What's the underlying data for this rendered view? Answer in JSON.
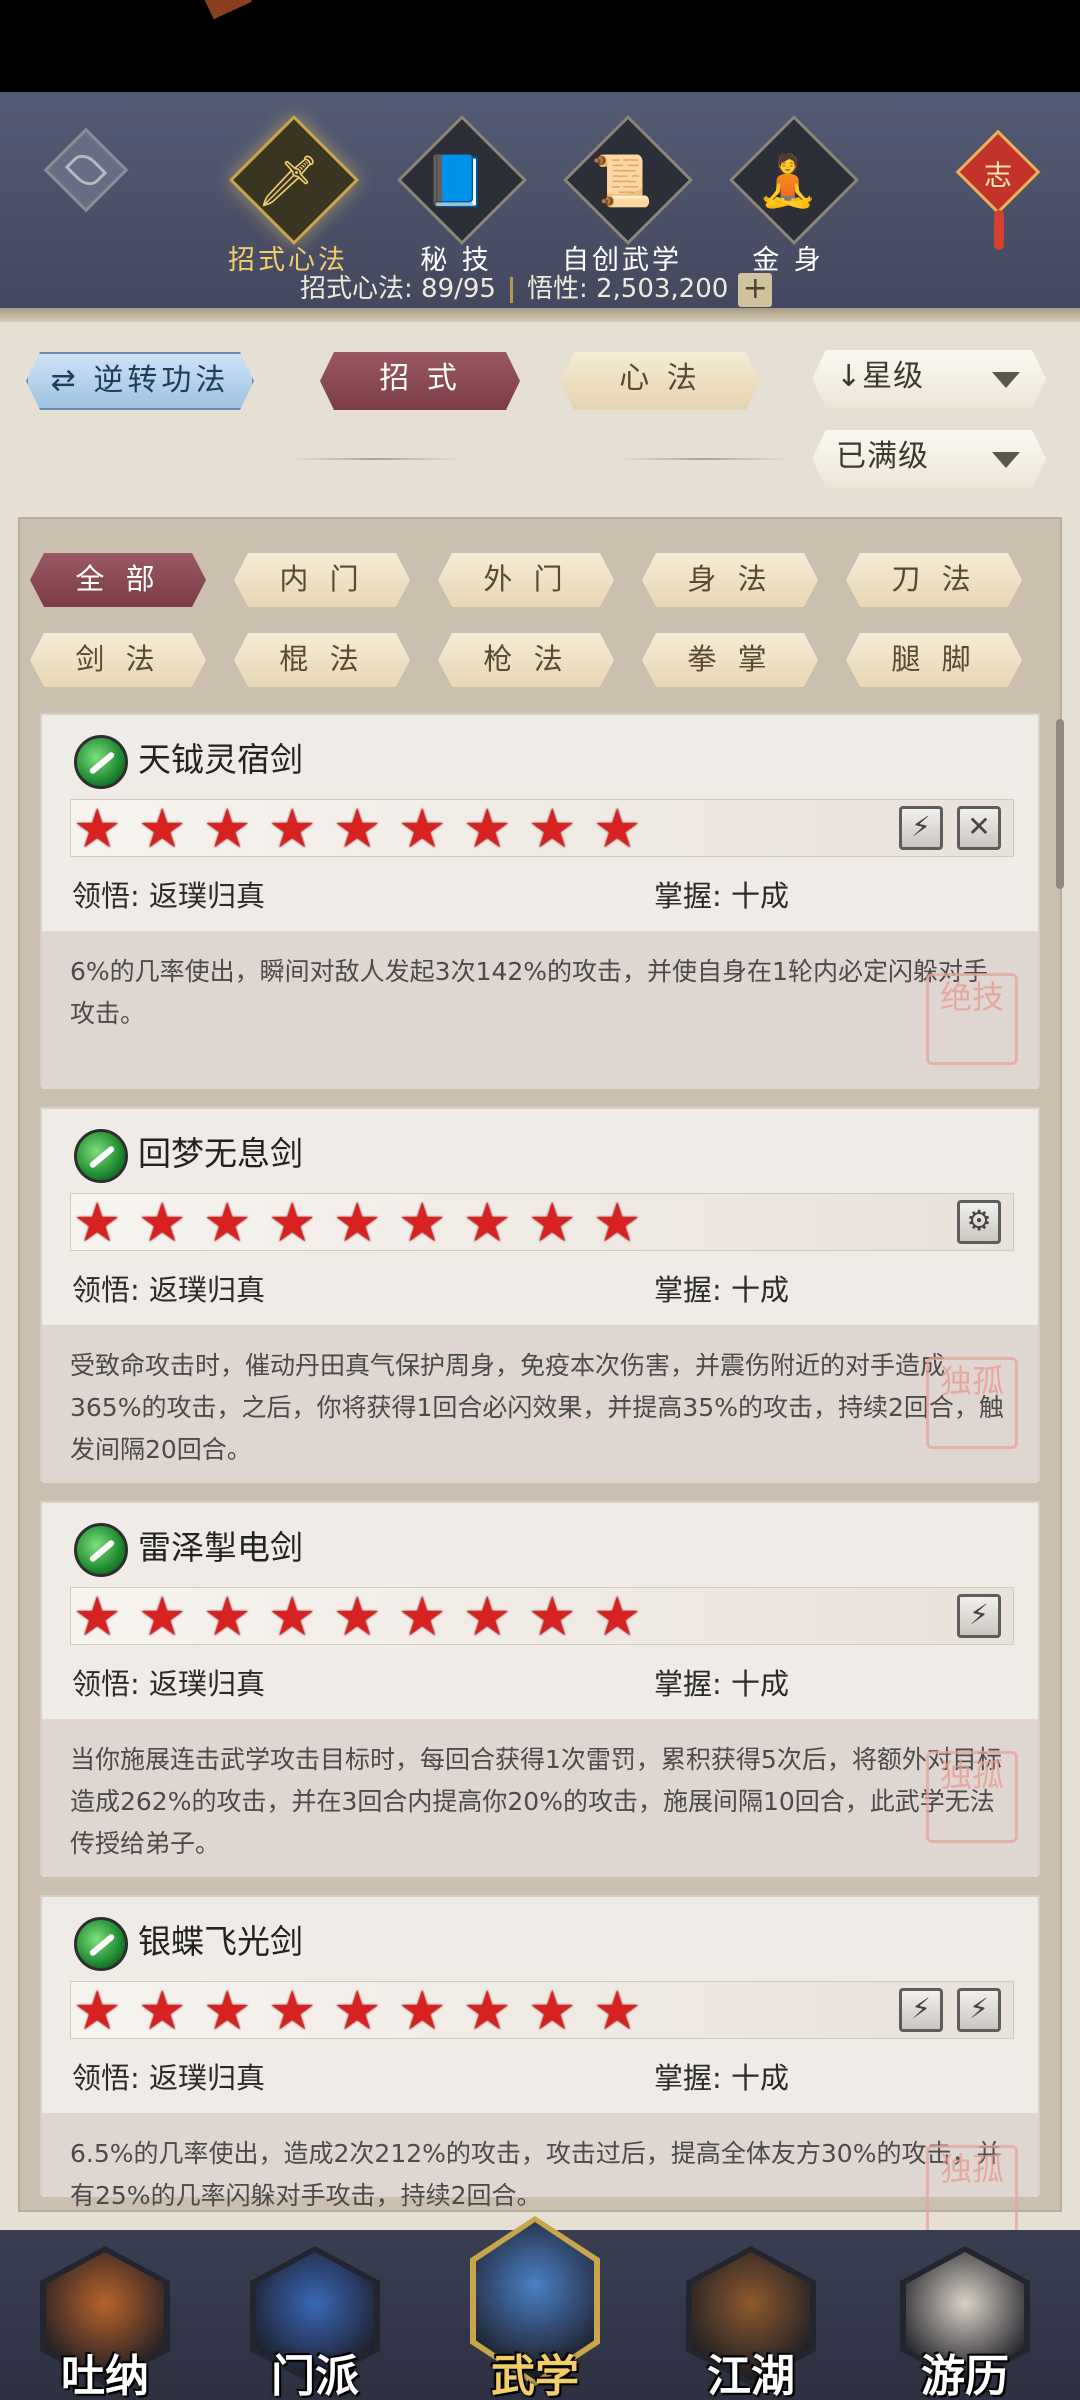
{
  "top_nav": {
    "tabs": [
      {
        "label": "招式心法",
        "icon": "sword-icon",
        "active": true
      },
      {
        "label": "秘 技",
        "icon": "book-icon",
        "active": false
      },
      {
        "label": "自创武学",
        "icon": "scroll-icon",
        "active": false
      },
      {
        "label": "金 身",
        "icon": "meditation-icon",
        "active": false
      }
    ],
    "knot_char": "志",
    "stats": {
      "moves_label": "招式心法: 89/95",
      "insight_label": "悟性: 2,503,200",
      "plus": "+"
    }
  },
  "toolbar": {
    "reverse_label": "逆转功法",
    "reverse_icon": "⇄",
    "move_tab": "招 式",
    "heart_tab": "心 法",
    "sort_label": "星级",
    "sort_arrow": "↓",
    "filter_label": "已满级"
  },
  "categories": [
    "全 部",
    "内 门",
    "外 门",
    "身 法",
    "刀 法",
    "剑 法",
    "棍 法",
    "枪 法",
    "拳 掌",
    "腿 脚"
  ],
  "active_category": "全 部",
  "skills": [
    {
      "name": "天钺灵宿剑",
      "stars": 9,
      "comprehension_label": "领悟: 返璞归真",
      "mastery_label": "掌握: 十成",
      "description": "6%的几率使出，瞬间对敌人发起3次142%的攻击，并使自身在1轮内必定闪躲对手攻击。",
      "badges": [
        "⚡",
        "✕"
      ],
      "seal": "绝技"
    },
    {
      "name": "回梦无息剑",
      "stars": 9,
      "comprehension_label": "领悟: 返璞归真",
      "mastery_label": "掌握: 十成",
      "description": "受致命攻击时，催动丹田真气保护周身，免疫本次伤害，并震伤附近的对手造成365%的攻击，之后，你将获得1回合必闪效果，并提高35%的攻击，持续2回合，触发间隔20回合。",
      "badges": [
        "⚙"
      ],
      "seal": "独孤"
    },
    {
      "name": "雷泽掣电剑",
      "stars": 9,
      "comprehension_label": "领悟: 返璞归真",
      "mastery_label": "掌握: 十成",
      "description": "当你施展连击武学攻击目标时，每回合获得1次雷罚，累积获得5次后，将额外对目标造成262%的攻击，并在3回合内提高你20%的攻击，施展间隔10回合，此武学无法传授给弟子。",
      "badges": [
        "⚡"
      ],
      "seal": "独孤"
    },
    {
      "name": "银蝶飞光剑",
      "stars": 9,
      "comprehension_label": "领悟: 返璞归真",
      "mastery_label": "掌握: 十成",
      "description": "6.5%的几率使出，造成2次212%的攻击，攻击过后，提高全体友方30%的攻击，并有25%的几率闪躲对手攻击，持续2回合。",
      "badges": [
        "⚡",
        "⚡"
      ],
      "seal": "独孤"
    }
  ],
  "bottom_nav": [
    {
      "label": "吐纳",
      "icon": "monk-icon",
      "color": "#b8632b",
      "active": false
    },
    {
      "label": "门派",
      "icon": "banner-icon",
      "color": "#3a67b8",
      "active": false
    },
    {
      "label": "武学",
      "icon": "manual-icon",
      "color": "#4b7fc4",
      "active": true
    },
    {
      "label": "江湖",
      "icon": "straw-hat-icon",
      "color": "#8c5a2c",
      "active": false
    },
    {
      "label": "游历",
      "icon": "horse-icon",
      "color": "#d9d2c7",
      "active": false
    }
  ],
  "colors": {
    "active_maroon": "#7c3d47",
    "star_red": "#d82121",
    "gold": "#f3cd6a"
  }
}
